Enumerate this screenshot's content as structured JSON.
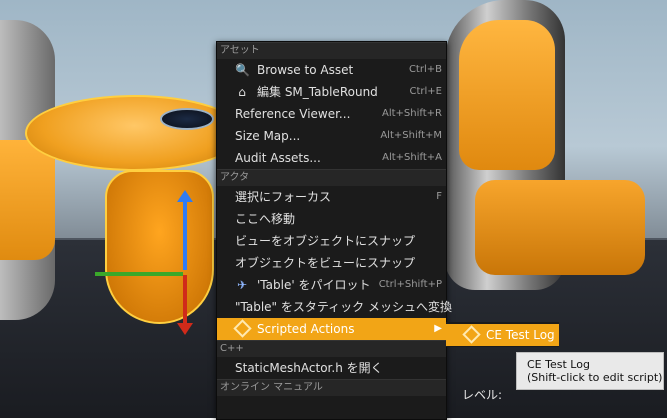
{
  "menu": {
    "sections": {
      "asset": "アセット",
      "actor": "アクタ",
      "cpp": "C++",
      "online_manual": "オンライン マニュアル"
    },
    "asset_items": [
      {
        "label": "Browse to Asset",
        "shortcut": "Ctrl+B",
        "icon": "magnifier-icon"
      },
      {
        "label": "編集 SM_TableRound",
        "shortcut": "Ctrl+E",
        "icon": "house-icon"
      },
      {
        "label": "Reference Viewer...",
        "shortcut": "Alt+Shift+R"
      },
      {
        "label": "Size Map...",
        "shortcut": "Alt+Shift+M"
      },
      {
        "label": "Audit Assets...",
        "shortcut": "Alt+Shift+A"
      }
    ],
    "actor_items": [
      {
        "label": "選択にフォーカス",
        "shortcut": "F"
      },
      {
        "label": "ここへ移動",
        "shortcut": ""
      },
      {
        "label": "ビューをオブジェクトにスナップ",
        "shortcut": ""
      },
      {
        "label": "オブジェクトをビューにスナップ",
        "shortcut": ""
      },
      {
        "label": "'Table' をパイロット",
        "shortcut": "Ctrl+Shift+P",
        "icon": "airplane-icon"
      },
      {
        "label": "\"Table\" をスタティック メッシュへ変換",
        "shortcut": ""
      },
      {
        "label": "Scripted Actions",
        "shortcut": "",
        "icon": "diamond-icon"
      }
    ],
    "cpp_items": [
      {
        "label": "StaticMeshActor.h を開く",
        "shortcut": ""
      }
    ]
  },
  "submenu": {
    "item_label": "CE Test Log"
  },
  "tooltip": {
    "line1": "CE Test Log",
    "line2": "(Shift-click to edit script)"
  },
  "viewport": {
    "level_label": "レベル:"
  },
  "colors": {
    "accent": "#f2a516",
    "menu_bg": "#1b1b1b"
  }
}
